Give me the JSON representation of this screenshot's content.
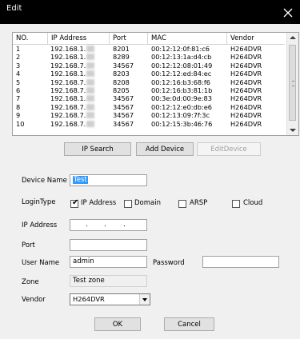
{
  "window": {
    "title": "Edit"
  },
  "device_list": {
    "columns": [
      "NO.",
      "IP Address",
      "Port",
      "MAC",
      "Vendor"
    ],
    "rows": [
      {
        "no": "1",
        "ip": "192.168.1.",
        "port": "8201",
        "mac": "00:12:12:0f:81:c6",
        "vendor": "H264DVR"
      },
      {
        "no": "2",
        "ip": "192.168.1.",
        "port": "8289",
        "mac": "00:12:13:1a:d4:cb",
        "vendor": "H264DVR"
      },
      {
        "no": "3",
        "ip": "192.168.7.",
        "port": "34567",
        "mac": "00:12:12:08:01:49",
        "vendor": "H264DVR"
      },
      {
        "no": "4",
        "ip": "192.168.1.",
        "port": "8203",
        "mac": "00:12:12:ed:84:ec",
        "vendor": "H264DVR"
      },
      {
        "no": "5",
        "ip": "192.168.7.",
        "port": "8208",
        "mac": "00:12:16:b3:68:f6",
        "vendor": "H264DVR"
      },
      {
        "no": "6",
        "ip": "192.168.7.",
        "port": "8205",
        "mac": "00:12:16:b3:81:1b",
        "vendor": "H264DVR"
      },
      {
        "no": "7",
        "ip": "192.168.1.",
        "port": "34567",
        "mac": "00:3e:0d:00:9e:83",
        "vendor": "H264DVR"
      },
      {
        "no": "8",
        "ip": "192.168.7.",
        "port": "34567",
        "mac": "00:12:12:e0:db:e6",
        "vendor": "H264DVR"
      },
      {
        "no": "9",
        "ip": "192.168.7.",
        "port": "34567",
        "mac": "00:12:13:09:7f:3c",
        "vendor": "H264DVR"
      },
      {
        "no": "10",
        "ip": "192.168.7.",
        "port": "34567",
        "mac": "00:12:15:3b:46:76",
        "vendor": "H264DVR"
      }
    ]
  },
  "buttons": {
    "ip_search": "IP Search",
    "add_device": "Add Device",
    "edit_device": "EditDevice",
    "ok": "OK",
    "cancel": "Cancel"
  },
  "form": {
    "device_name_label": "Device Name",
    "device_name_value": "Test",
    "login_type_label": "LoginType",
    "login_types": [
      {
        "label": "IP Address",
        "checked": true
      },
      {
        "label": "Domain",
        "checked": false
      },
      {
        "label": "ARSP",
        "checked": false
      },
      {
        "label": "Cloud",
        "checked": false
      }
    ],
    "ip_address_label": "IP Address",
    "port_label": "Port",
    "port_value": "",
    "user_name_label": "User Name",
    "user_name_value": "admin",
    "password_label": "Password",
    "password_value": "",
    "zone_label": "Zone",
    "zone_value": "Test zone",
    "vendor_label": "Vendor",
    "vendor_value": "H264DVR"
  }
}
